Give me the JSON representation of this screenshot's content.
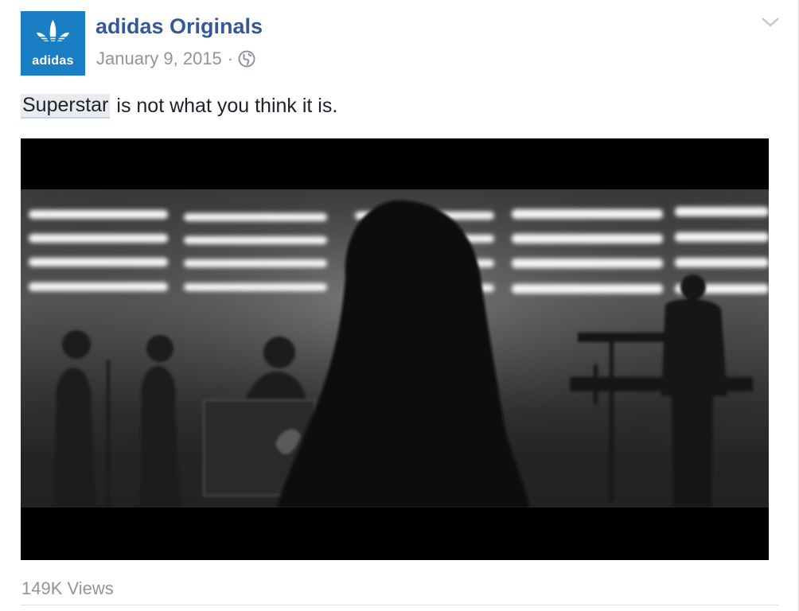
{
  "post": {
    "page_name": "adidas Originals",
    "avatar_text": "adidas",
    "date": "January 9, 2015",
    "separator": "·",
    "privacy_icon": "globe-icon",
    "options_icon": "chevron-down-icon",
    "text_tag": "Superstar",
    "text_rest": "is not what you think it is.",
    "video": {
      "icon": "video-thumbnail"
    },
    "views": "149K Views"
  },
  "colors": {
    "link": "#365899",
    "meta": "#90949c",
    "brand_blue": "#1a7ec4"
  }
}
